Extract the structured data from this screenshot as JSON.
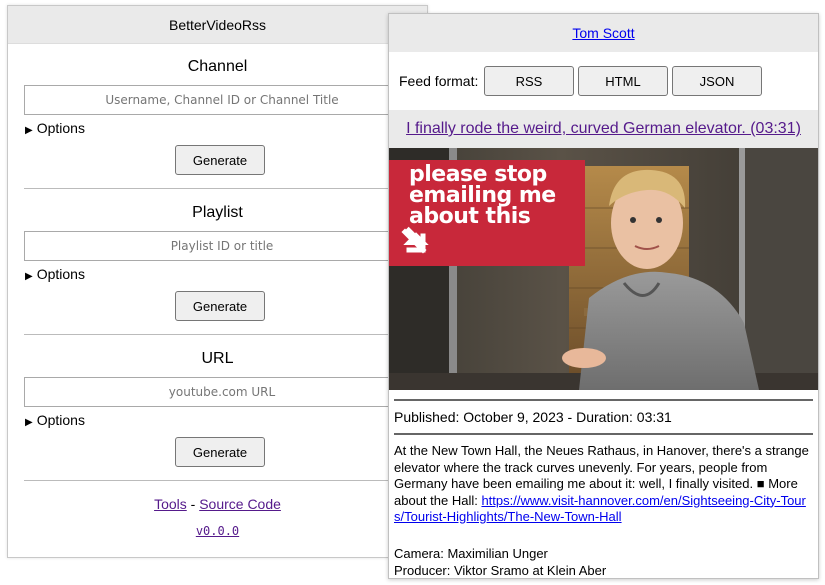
{
  "left": {
    "title": "BetterVideoRss",
    "channel": {
      "heading": "Channel",
      "placeholder": "Username, Channel ID or Channel Title",
      "options": "Options",
      "generate": "Generate"
    },
    "playlist": {
      "heading": "Playlist",
      "placeholder": "Playlist ID or title",
      "options": "Options",
      "generate": "Generate"
    },
    "url": {
      "heading": "URL",
      "placeholder": "youtube.com URL",
      "options": "Options",
      "generate": "Generate"
    },
    "footer": {
      "tools": "Tools",
      "separator": " - ",
      "source": "Source Code",
      "version": "v0.0.0"
    }
  },
  "right": {
    "channel_name": "Tom Scott",
    "feed_label": "Feed format:",
    "formats": [
      "RSS",
      "HTML",
      "JSON"
    ],
    "video_title": "I finally rode the weird, curved German elevator. (03:31)",
    "thumbnail_text": "please stop emailing me about this",
    "published": "Published: October 9, 2023 - Duration: 03:31",
    "description": "At the New Town Hall, the Neues Rathaus, in Hanover, there's a strange elevator where the track curves unevenly. For years, people from Germany have been emailing me about it: well, I finally visited. ■ More about the Hall: ",
    "description_link": "https://www.visit-hannover.com/en/Sightseeing-City-Tours/Tourist-Highlights/The-New-Town-Hall",
    "camera": "Camera: Maximilian Unger",
    "producer": "Producer: Viktor Sramo at Klein Aber"
  },
  "colors": {
    "header_bg": "#eaeaea",
    "link_visited": "#551a8b",
    "link": "#0000ee",
    "thumb_red": "#c8283a"
  }
}
